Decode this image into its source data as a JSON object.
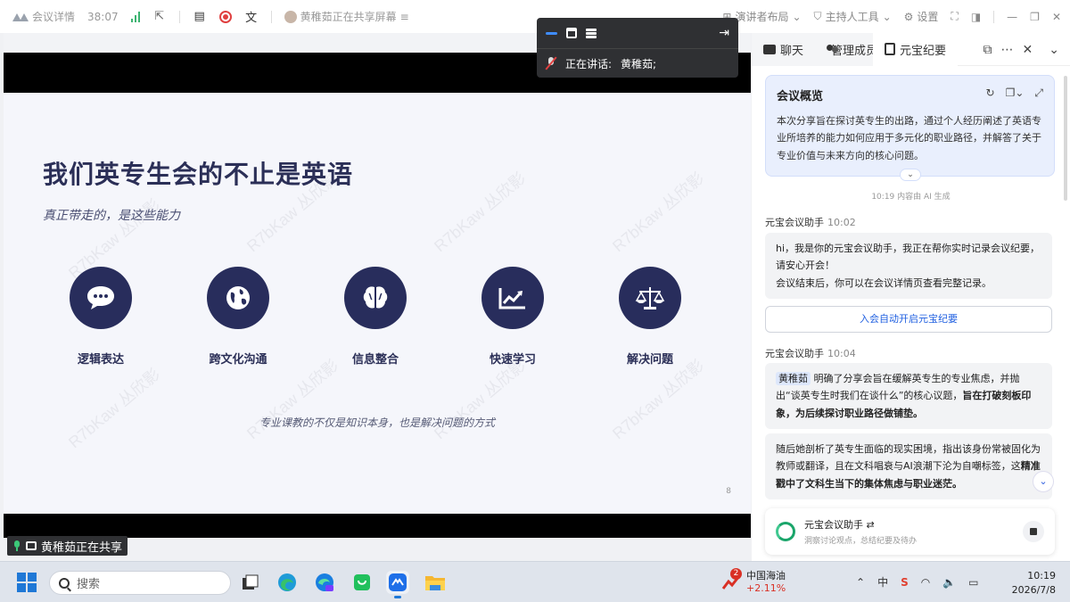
{
  "topbar": {
    "meeting_details": "会议详情",
    "duration": "38:07",
    "sharing_status": "黄稚茹正在共享屏幕",
    "layout": "演讲者布局",
    "host_tools": "主持人工具",
    "settings": "设置"
  },
  "float_box": {
    "speaking_label": "正在讲话:",
    "speaker": "黄稚茹;"
  },
  "slide": {
    "title": "我们英专生会的不止是英语",
    "subtitle": "真正带走的，是这些能力",
    "features": [
      {
        "label": "逻辑表达",
        "icon": "speech-bubble-icon"
      },
      {
        "label": "跨文化沟通",
        "icon": "globe-icon"
      },
      {
        "label": "信息整合",
        "icon": "brain-icon"
      },
      {
        "label": "快速学习",
        "icon": "trend-chart-icon"
      },
      {
        "label": "解决问题",
        "icon": "balance-scale-icon"
      }
    ],
    "footer": "专业课教的不仅是知识本身，也是解决问题的方式",
    "page": "8",
    "watermark": "R7bKaw 丛欣影"
  },
  "sharing_tag": "黄稚茹正在共享",
  "panel": {
    "tabs": [
      "聊天",
      "管理成员",
      "元宝纪要"
    ],
    "summary": {
      "title": "会议概览",
      "body": "本次分享旨在探讨英专生的出路，通过个人经历阐述了英语专业所培养的能力如何应用于多元化的职业路径，并解答了关于专业价值与未来方向的核心问题。",
      "generated": "10:19 内容由 AI 生成"
    },
    "messages": [
      {
        "sender": "元宝会议助手",
        "time": "10:02",
        "line1": "hi，我是你的元宝会议助手，我正在帮你实时记录会议纪要，请安心开会！",
        "line2": "会议结束后，你可以在会议详情页查看完整记录。"
      },
      {
        "sender": "元宝会议助手",
        "time": "10:04",
        "name_chip": "黄稚茹",
        "para1_plain": "明确了分享会旨在缓解英专生的专业焦虑，并抛出“谈英专生时我们在谈什么”的核心议题，",
        "para1_bold": "旨在打破刻板印象，为后续探讨职业路径做铺垫。",
        "para2_plain": "随后她剖析了英专生面临的现实困境，指出该身份常被固化为教师或翻译，且在文科唱衰与AI浪潮下沦为自嘲标签，这",
        "para2_bold": "精准戳中了文科生当下的集体焦虑与职业迷茫。"
      }
    ],
    "auto_button": "入会自动开启元宝纪要",
    "assistant": {
      "name": "元宝会议助手",
      "desc": "洞察讨论观点，总结纪要及待办"
    }
  },
  "taskbar": {
    "search_placeholder": "搜索",
    "stock_name": "中国海油",
    "stock_change": "+2.11%",
    "stock_badge": "2",
    "ime": "中",
    "time": "10:19",
    "date": "2026/7/8"
  }
}
